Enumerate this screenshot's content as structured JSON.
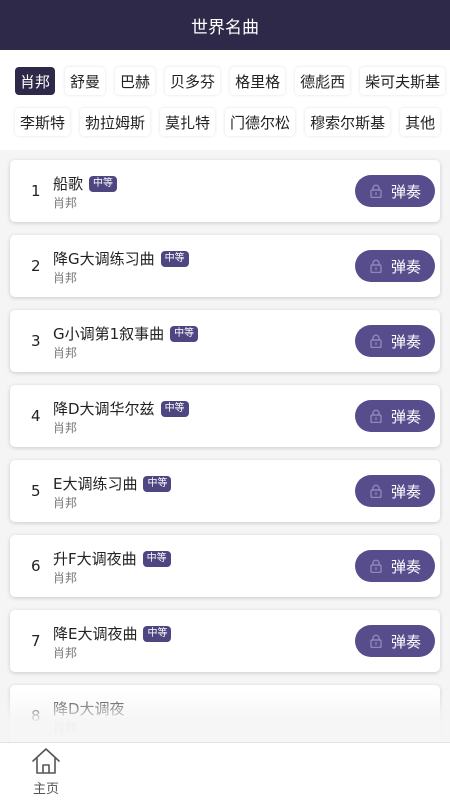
{
  "header": {
    "title": "世界名曲"
  },
  "composers": {
    "rows": [
      [
        {
          "label": "肖邦",
          "active": true
        },
        {
          "label": "舒曼"
        },
        {
          "label": "巴赫"
        },
        {
          "label": "贝多芬"
        },
        {
          "label": "格里格"
        },
        {
          "label": "德彪西"
        },
        {
          "label": "柴可夫斯基"
        }
      ],
      [
        {
          "label": "李斯特"
        },
        {
          "label": "勃拉姆斯"
        },
        {
          "label": "莫扎特"
        },
        {
          "label": "门德尔松"
        },
        {
          "label": "穆索尔斯基"
        },
        {
          "label": "其他"
        }
      ]
    ]
  },
  "songs": [
    {
      "index": "1",
      "title": "船歌",
      "level": "中等",
      "composer": "肖邦",
      "action": "弹奏",
      "locked": true
    },
    {
      "index": "2",
      "title": "降G大调练习曲",
      "level": "中等",
      "composer": "肖邦",
      "action": "弹奏",
      "locked": true
    },
    {
      "index": "3",
      "title": "G小调第1叙事曲",
      "level": "中等",
      "composer": "肖邦",
      "action": "弹奏",
      "locked": true
    },
    {
      "index": "4",
      "title": "降D大调华尔兹",
      "level": "中等",
      "composer": "肖邦",
      "action": "弹奏",
      "locked": true
    },
    {
      "index": "5",
      "title": "E大调练习曲",
      "level": "中等",
      "composer": "肖邦",
      "action": "弹奏",
      "locked": true
    },
    {
      "index": "6",
      "title": "升F大调夜曲",
      "level": "中等",
      "composer": "肖邦",
      "action": "弹奏",
      "locked": true
    },
    {
      "index": "7",
      "title": "降E大调夜曲",
      "level": "中等",
      "composer": "肖邦",
      "action": "弹奏",
      "locked": true
    },
    {
      "index": "8",
      "title": "降D大调夜",
      "level": "",
      "composer": "肖邦",
      "action": "",
      "locked": false
    }
  ],
  "tabbar": {
    "home_label": "主页",
    "home_icon": "home-icon"
  },
  "colors": {
    "header_bg": "#2f2949",
    "button_bg": "#574d8c",
    "badge_bg": "#4e4680"
  }
}
